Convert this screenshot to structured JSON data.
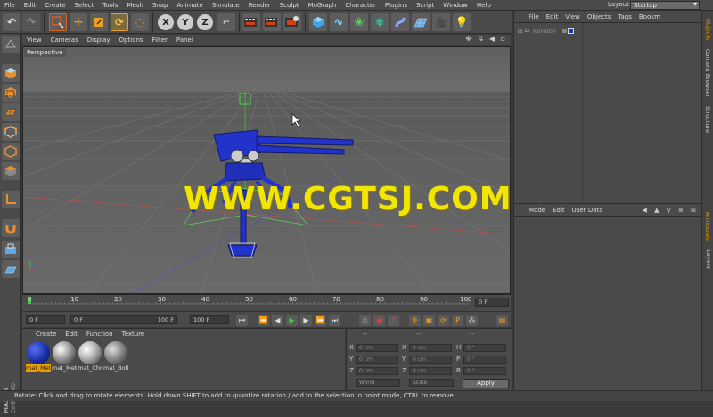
{
  "menubar": {
    "items": [
      "File",
      "Edit",
      "Create",
      "Select",
      "Tools",
      "Mesh",
      "Snap",
      "Animate",
      "Simulate",
      "Render",
      "Sculpt",
      "MoGraph",
      "Character",
      "Plugins",
      "Script",
      "Window",
      "Help"
    ],
    "layout_label": "Layout:",
    "layout_value": "Startup"
  },
  "toolbar": {
    "axis_x": "X",
    "axis_y": "Y",
    "axis_z": "Z"
  },
  "viewport": {
    "menu": [
      "View",
      "Cameras",
      "Display",
      "Options",
      "Filter",
      "Panel"
    ],
    "nav_icons": "✥ ⇅ ◀ ▫",
    "label": "Perspective",
    "watermark": "WWW.CGTSJ.COM"
  },
  "timeline": {
    "ticks": [
      "0",
      "10",
      "20",
      "30",
      "40",
      "50",
      "60",
      "70",
      "80",
      "90",
      "100"
    ],
    "current_frame": "0 F",
    "field_start": "0 F",
    "field_cur": "0 F",
    "field_maxleft": "100 F",
    "field_end": "100 F"
  },
  "materials": {
    "menu": [
      "Create",
      "Edit",
      "Function",
      "Texture"
    ],
    "items": [
      {
        "name": "mat_Met",
        "color": "#1a2fa8",
        "selected": true
      },
      {
        "name": "mat_Met",
        "color": "#9a9a9a",
        "selected": false
      },
      {
        "name": "mat_Chr",
        "color": "#b0b0b0",
        "selected": false
      },
      {
        "name": "mat_Bolt",
        "color": "#8a8a8a",
        "selected": false
      }
    ]
  },
  "coords": {
    "header": [
      "--",
      "--",
      "--"
    ],
    "rows": [
      {
        "l1": "X",
        "v1": "0 cm",
        "l2": "X",
        "v2": "0 cm",
        "l3": "H",
        "v3": "0 °"
      },
      {
        "l1": "Y",
        "v1": "0 cm",
        "l2": "Y",
        "v2": "0 cm",
        "l3": "P",
        "v3": "0 °"
      },
      {
        "l1": "Z",
        "v1": "0 cm",
        "l2": "Z",
        "v2": "0 cm",
        "l3": "B",
        "v3": "0 °"
      }
    ],
    "space": "World",
    "mode": "Scale",
    "apply": "Apply"
  },
  "object_manager": {
    "menu": [
      "File",
      "Edit",
      "View",
      "Objects",
      "Tags",
      "Bookm"
    ],
    "object_name": "Turret07"
  },
  "attribute_manager": {
    "menu": [
      "Mode",
      "Edit",
      "User Data"
    ]
  },
  "side_tabs": {
    "objects": "Objects",
    "content_browser": "Content Browser",
    "structure": "Structure",
    "attributes": "Attributes",
    "layers": "Layers"
  },
  "statusbar": {
    "text": "Rotate: Click and drag to rotate elements. Hold down SHIFT to add to quantize rotation / add to the selection in point mode, CTRL to remove."
  },
  "branding": {
    "maxon": "MAXON",
    "cinema": "CINEMA 4D"
  },
  "colors": {
    "accent_orange": "#e8a000",
    "watermark_yellow": "#f2e600",
    "model_blue": "#2233cc"
  }
}
